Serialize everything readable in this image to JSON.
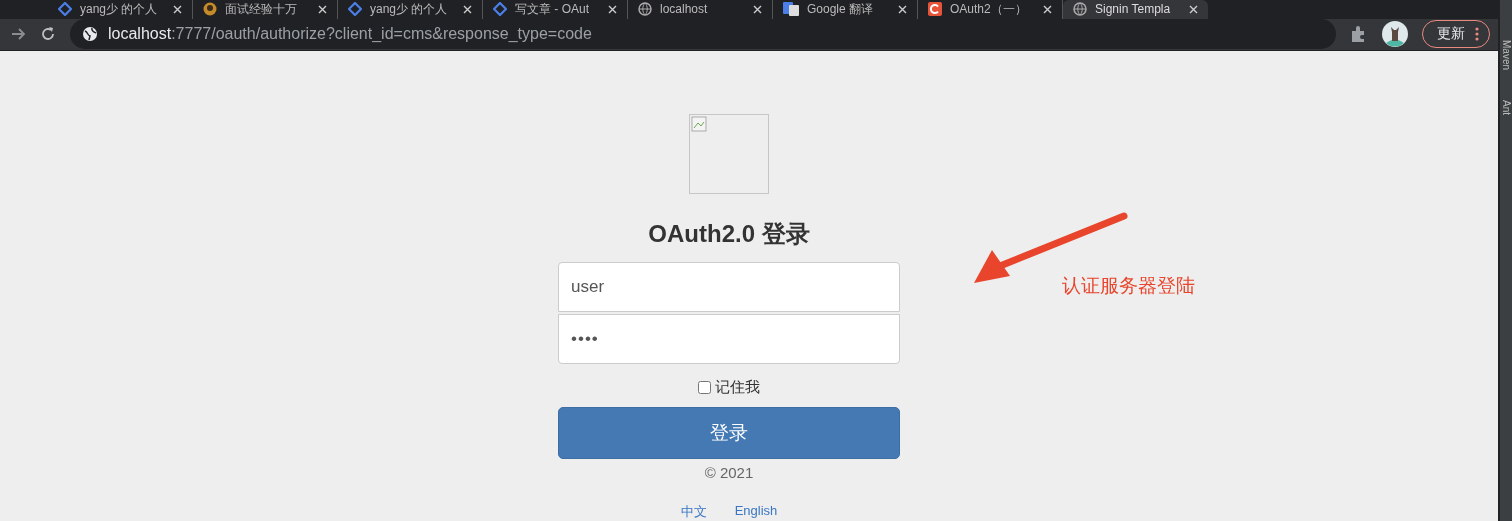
{
  "tabs": [
    {
      "title": "yang少 的个人",
      "kind": "diamond",
      "selected": false
    },
    {
      "title": "面试经验十万",
      "kind": "avatar",
      "selected": false
    },
    {
      "title": "yang少 的个人",
      "kind": "diamond",
      "selected": false
    },
    {
      "title": "写文章 - OAut",
      "kind": "diamond",
      "selected": false
    },
    {
      "title": "localhost",
      "kind": "globe",
      "selected": false
    },
    {
      "title": "Google 翻译",
      "kind": "translate",
      "selected": false
    },
    {
      "title": "OAuth2（一）",
      "kind": "letter",
      "selected": false
    },
    {
      "title": "Signin Templa",
      "kind": "globe",
      "selected": true
    }
  ],
  "address_bar": {
    "host": "localhost",
    "path": ":7777/oauth/authorize?client_id=cms&response_type=code"
  },
  "update_button": "更新",
  "side_panel": [
    "Maven",
    "Ant"
  ],
  "login": {
    "title": "OAuth2.0 登录",
    "fields": [
      {
        "kind": "text",
        "value": "user"
      },
      {
        "kind": "password",
        "value": "••••"
      }
    ],
    "remember": {
      "label": "记住我",
      "checked": false
    },
    "submit": "登录",
    "copyright": "© 2021",
    "languages": [
      "中文",
      "English"
    ]
  },
  "annotation": "认证服务器登陆"
}
